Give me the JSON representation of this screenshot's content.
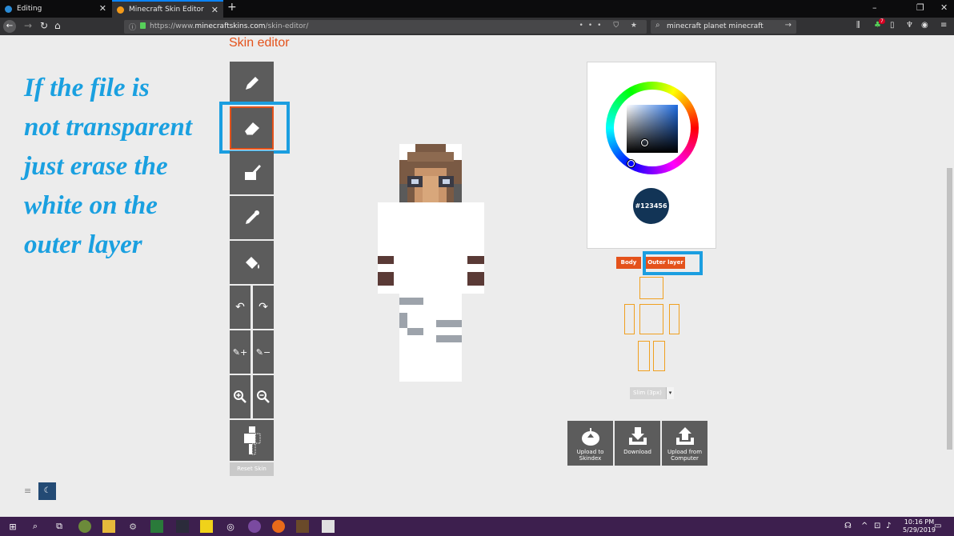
{
  "browser": {
    "tabs": [
      {
        "title": "Editing",
        "close": "✕"
      },
      {
        "title": "Minecraft Skin Editor",
        "close": "✕"
      }
    ],
    "new_tab": "+",
    "url_prefix": "https://www.",
    "url_domain": "minecraftskins.com",
    "url_path": "/skin-editor/",
    "url_actions": "••• ⛉ ★",
    "search_query": "minecraft planet minecraft",
    "win_min": "–",
    "win_max": "❐",
    "win_close": "✕",
    "badge": "7"
  },
  "page": {
    "title": "Skin editor",
    "annotation_lines": [
      "If the file is",
      "not transparent",
      "just erase the",
      "white on the",
      "outer layer"
    ],
    "reset_label": "Reset Skin",
    "color": {
      "hex": "#123456"
    },
    "layers": {
      "body": "Body",
      "outer": "Outer layer"
    },
    "model_select": {
      "value": "Slim (3px)"
    },
    "actions": {
      "upload_skindex": "Upload to Skindex",
      "download": "Download",
      "upload_computer": "Upload from Computer"
    }
  },
  "taskbar": {
    "time": "10:16 PM",
    "date": "5/29/2019"
  },
  "colors": {
    "accent": "#e4521b",
    "highlight": "#1b9ee0",
    "tool_bg": "#5c5c5c",
    "taskbar": "#3d1f4e"
  }
}
